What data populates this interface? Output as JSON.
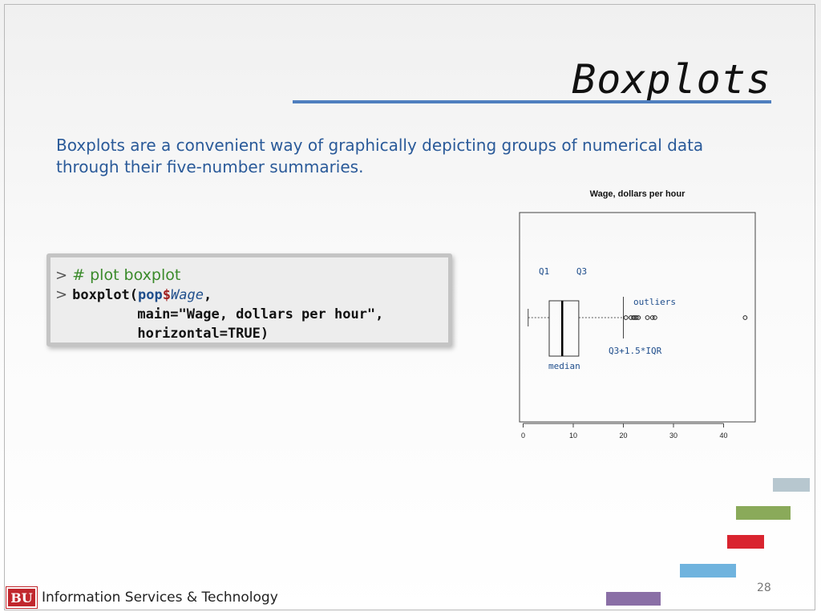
{
  "slide": {
    "title": "Boxplots",
    "intro": "Boxplots are a convenient way of graphically depicting groups of numerical data through their five-number summaries.",
    "page_number": "28",
    "footer_logo": "BU",
    "footer_department": "Information Services & Technology"
  },
  "code": {
    "prompt": ">",
    "comment": "# plot boxplot",
    "call_fn": "boxplot(",
    "call_obj": "pop",
    "call_dollar": "$",
    "call_var": "Wage",
    "call_comma": ",",
    "line3": "main=\"Wage, dollars per hour\",",
    "line4": "horizontal=TRUE)"
  },
  "colors": {
    "title_rule": "#4f7fbf",
    "intro_text": "#2a5a99",
    "comment": "#3a8a2a",
    "annotation": "#1f4e8c",
    "deco_blocks": [
      "#b7c7cf",
      "#8aaa5a",
      "#d9242f",
      "#6fb3de",
      "#8a6fa6"
    ]
  },
  "chart_data": {
    "type": "boxplot",
    "title": "Wage, dollars per hour",
    "orientation": "horizontal",
    "xlim": [
      0,
      45
    ],
    "ticks": [
      0,
      10,
      20,
      30,
      40
    ],
    "summary": {
      "whisker_low": 1,
      "q1": 5.2,
      "median": 7.8,
      "q3": 11.1,
      "whisker_high": 20
    },
    "outliers": [
      20.5,
      21.5,
      22,
      22.3,
      22.6,
      23,
      24.8,
      25.8,
      26.3,
      44.3
    ],
    "annotations": {
      "q1": "Q1",
      "q3": "Q3",
      "median": "median",
      "outliers": "outliers",
      "upper_fence": "Q3+1.5*IQR"
    }
  }
}
